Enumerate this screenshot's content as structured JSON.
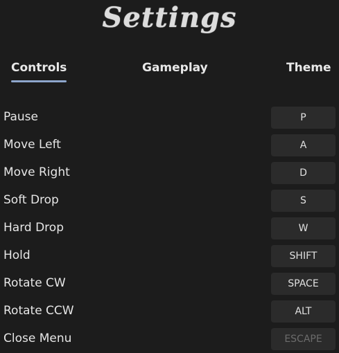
{
  "title": "Settings",
  "tabs": [
    {
      "label": "Controls",
      "active": true
    },
    {
      "label": "Gameplay",
      "active": false
    },
    {
      "label": "Theme",
      "active": false
    }
  ],
  "controls": [
    {
      "action": "Pause",
      "key": "P"
    },
    {
      "action": "Move Left",
      "key": "A"
    },
    {
      "action": "Move Right",
      "key": "D"
    },
    {
      "action": "Soft Drop",
      "key": "S"
    },
    {
      "action": "Hard Drop",
      "key": "W"
    },
    {
      "action": "Hold",
      "key": "SHIFT"
    },
    {
      "action": "Rotate CW",
      "key": "SPACE"
    },
    {
      "action": "Rotate CCW",
      "key": "ALT"
    },
    {
      "action": "Close Menu",
      "key": "ESCAPE",
      "disabled": true
    }
  ],
  "colors": {
    "background": "#1c1c1c",
    "key_button": "#2b2b2b",
    "active_tab_underline": "#8ea6cc",
    "disabled_text": "#6c6c6c"
  }
}
